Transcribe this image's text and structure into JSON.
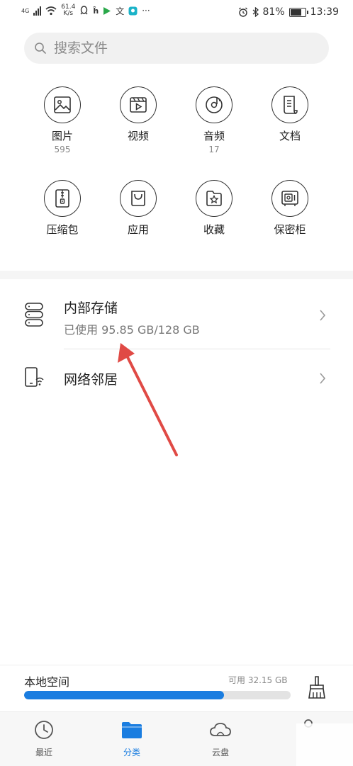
{
  "status_bar": {
    "network": "4G",
    "speed_value": "61.4",
    "speed_unit": "K/s",
    "battery": "81%",
    "battery_level": 0.81,
    "time": "13:39"
  },
  "search": {
    "placeholder": "搜索文件"
  },
  "categories": [
    {
      "label": "图片",
      "count": "595",
      "icon": "image-icon"
    },
    {
      "label": "视频",
      "count": "",
      "icon": "video-icon"
    },
    {
      "label": "音频",
      "count": "17",
      "icon": "audio-icon"
    },
    {
      "label": "文档",
      "count": "",
      "icon": "document-icon"
    },
    {
      "label": "压缩包",
      "count": "",
      "icon": "archive-icon"
    },
    {
      "label": "应用",
      "count": "",
      "icon": "app-bag-icon"
    },
    {
      "label": "收藏",
      "count": "",
      "icon": "favorite-icon"
    },
    {
      "label": "保密柜",
      "count": "",
      "icon": "safe-icon"
    }
  ],
  "storage": {
    "internal": {
      "title": "内部存储",
      "usage": "已使用 95.85 GB/128 GB"
    },
    "network": {
      "title": "网络邻居"
    }
  },
  "local_space": {
    "title": "本地空间",
    "free": "可用 32.15 GB",
    "used_fraction": 0.75
  },
  "tabs": [
    {
      "label": "最近",
      "icon": "clock-icon",
      "active": false
    },
    {
      "label": "分类",
      "icon": "folder-icon",
      "active": true
    },
    {
      "label": "云盘",
      "icon": "cloud-icon",
      "active": false
    }
  ],
  "colors": {
    "accent": "#1a7de0",
    "annotation_arrow": "#e04a45"
  }
}
